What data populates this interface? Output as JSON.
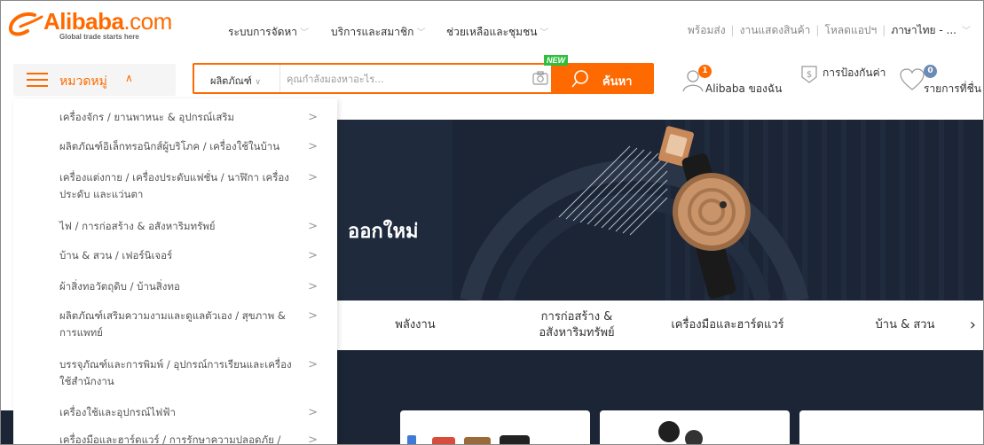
{
  "brand": {
    "name": "Alibaba",
    "domain": ".com",
    "tagline": "Global trade starts here"
  },
  "top_nav": [
    {
      "label": "ระบบการจัดหา"
    },
    {
      "label": "บริการและสมาชิก"
    },
    {
      "label": "ช่วยเหลือและชุมชน"
    }
  ],
  "top_links": {
    "ready_to_ship": "พร้อมส่ง",
    "trade_shows": "งานแสดงสินค้า",
    "get_app": "โหลดแอปฯ",
    "language": "ภาษาไทย - ..."
  },
  "categories_button": {
    "label": "หมวดหมู่"
  },
  "search": {
    "type_label": "ผลิตภัณฑ์",
    "placeholder": "คุณกำลังมองหาอะไร...",
    "button_label": "ค้นหา",
    "new_badge": "NEW"
  },
  "account": {
    "label": "Alibaba ของฉัน",
    "badge_count": "1"
  },
  "protection": {
    "label": "การป้องกันค่า"
  },
  "favorites": {
    "label": "รายการที่ชื่น",
    "badge_count": "0"
  },
  "category_menu": [
    {
      "label": "เครื่องจักร / ยานพาหนะ & อุปกรณ์เสริม"
    },
    {
      "label": "ผลิตภัณฑ์อิเล็กทรอนิกส์ผู้บริโภค / เครื่องใช้ในบ้าน"
    },
    {
      "label": "เครื่องแต่งกาย / เครื่องประดับแฟชั่น / นาฬิกา เครื่องประดับ และแว่นตา"
    },
    {
      "label": "ไฟ / การก่อสร้าง & อสังหาริมทรัพย์"
    },
    {
      "label": "บ้าน & สวน / เฟอร์นิเจอร์"
    },
    {
      "label": "ผ้าสิ่งทอวัตถุดิบ / บ้านสิ่งทอ"
    },
    {
      "label": "ผลิตภัณฑ์เสริมความงามและดูแลตัวเอง / สุขภาพ & การแพทย์"
    },
    {
      "label": "บรรจุภัณฑ์และการพิมพ์ / อุปกรณ์การเรียนและเครื่องใช้สำนักงาน"
    },
    {
      "label": "เครื่องใช้และอุปกรณ์ไฟฟ้า"
    },
    {
      "label": "เครื่องมือและฮาร์ดแวร์ / การรักษาความปลอดภัย /"
    }
  ],
  "hero": {
    "title": "ออกใหม่"
  },
  "category_strip": [
    {
      "label": "พลังงาน"
    },
    {
      "label": "การก่อสร้าง & อสังหาริมทรัพย์"
    },
    {
      "label": "เครื่องมือและฮาร์ดแวร์"
    },
    {
      "label": "บ้าน & สวน"
    }
  ],
  "colors": {
    "accent": "#ff6a00",
    "dark_bg": "#1b2535",
    "new_badge": "#2fbf3e"
  }
}
